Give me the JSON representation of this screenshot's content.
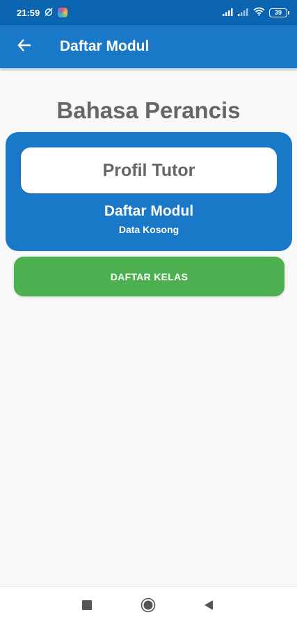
{
  "status_bar": {
    "time": "21:59",
    "battery": "39"
  },
  "app_bar": {
    "title": "Daftar Modul",
    "back_icon": "arrow-left-icon"
  },
  "main": {
    "heading": "Bahasa Perancis",
    "card": {
      "profile_button_label": "Profil Tutor",
      "title": "Daftar Modul",
      "subtitle": "Data Kosong"
    },
    "class_button_label": "DAFTAR KELAS"
  },
  "colors": {
    "status_bar": "#0b64b0",
    "primary": "#1a78c8",
    "success": "#4caf50",
    "heading_text": "#666666"
  },
  "nav": {
    "recents_icon": "square-icon",
    "home_icon": "circle-icon",
    "back_icon": "triangle-back-icon"
  }
}
